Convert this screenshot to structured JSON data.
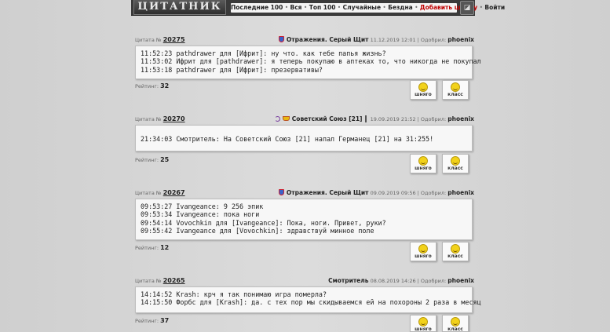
{
  "site": {
    "logo": "ЦИТАТНИК",
    "nav": [
      {
        "label": "Последние 100"
      },
      {
        "label": "Вся"
      },
      {
        "label": "Топ 100"
      },
      {
        "label": "Случайные"
      },
      {
        "label": "Бездна"
      },
      {
        "label": "Добавить цитату"
      },
      {
        "label": "Войти"
      }
    ]
  },
  "labels": {
    "quote_prefix": "Цитата №",
    "approved": "Одобрил:",
    "rating": "Рейтинг:",
    "vote_bad": "шняго",
    "vote_good": "класс"
  },
  "quotes": [
    {
      "id": "20275",
      "source": "Отражения. Серый Щит",
      "date": "11.12.2019 12:01",
      "approver": "phoenix",
      "lines": [
        "11:52:23 pathdrawer для [Ифрит]: ну что. как тебе папья жизнь?",
        "11:53:02 Ифрит для [pathdrawer]: я теперь покупаю в аптеках то, что никогда не покупал",
        "11:53:18 pathdrawer для [Ифрит]: презервативы?"
      ],
      "rating": "32"
    },
    {
      "id": "20270",
      "source": "Советский Союз [21]",
      "date": "19.09.2019 21:52",
      "approver": "phoenix",
      "lines": [
        "21:34:03 Смотритель: На Советский Союз [21] напал Германец [21] на 31:255!"
      ],
      "rating": "25"
    },
    {
      "id": "20267",
      "source": "Отражения. Серый Щит",
      "date": "09.09.2019 09:56",
      "approver": "phoenix",
      "lines": [
        "09:53:27 Ivangeance: 9 256 эпик",
        "09:53:34 Ivangeance: пока ноги",
        "09:54:14 Vovochkin для [Ivangeance]: Пока, ноги. Привет, руки?",
        "09:55:42 Ivangeance для [Vovochkin]: здравствуй минное поле"
      ],
      "rating": "12"
    },
    {
      "id": "20265",
      "source": "Смотритель",
      "date": "08.08.2019 14:26",
      "approver": "phoenix",
      "lines": [
        "14:14:52 Krash: крч я так понимаю игра померла?",
        "14:15:50 Форбс для [Krash]: да. с тех пор мы скидываемся ей на похороны 2 раза в месяц"
      ],
      "rating": "37"
    }
  ]
}
